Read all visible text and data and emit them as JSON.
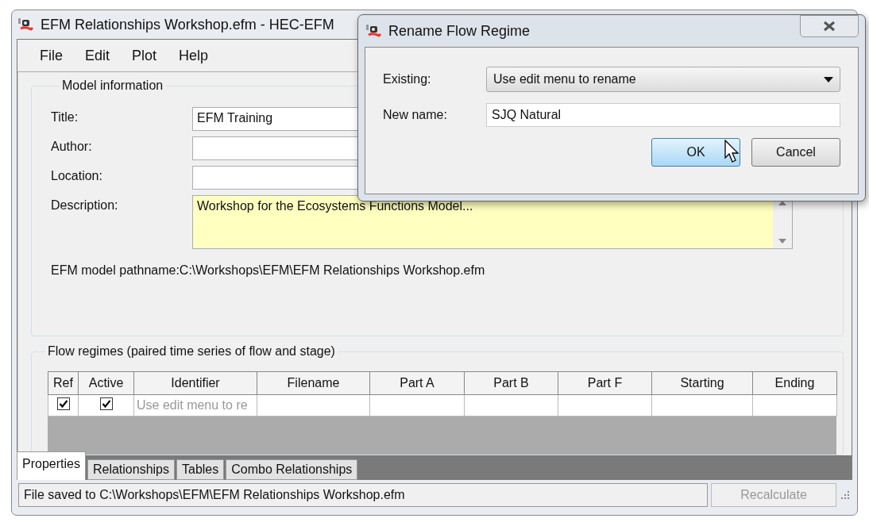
{
  "window": {
    "title": "EFM Relationships Workshop.efm - HEC-EFM"
  },
  "menu": [
    "File",
    "Edit",
    "Plot",
    "Help"
  ],
  "model_info": {
    "title": "Model information",
    "fields": [
      {
        "label": "Title:",
        "value": "EFM Training",
        "kind": "text"
      },
      {
        "label": "Author:",
        "kind": "text"
      },
      {
        "label": "Location:",
        "kind": "text"
      },
      {
        "label": "Description:",
        "value": "Workshop for the Ecosystems Functions Model...",
        "kind": "memo"
      }
    ],
    "pathname": "EFM model pathname:C:\\Workshops\\EFM\\EFM Relationships Workshop.efm"
  },
  "flow_regimes": {
    "title": "Flow regimes (paired time series of flow and stage)",
    "columns": [
      "Ref",
      "Active",
      "Identifier",
      "Filename",
      "Part A",
      "Part B",
      "Part F",
      "Starting",
      "Ending"
    ],
    "rows": [
      {
        "ref": true,
        "active": true,
        "identifier": "Use edit menu to re"
      }
    ]
  },
  "tabs": [
    {
      "label": "Properties",
      "selected": true
    },
    {
      "label": "Relationships",
      "selected": false
    },
    {
      "label": "Tables",
      "selected": false
    },
    {
      "label": "Combo Relationships",
      "selected": false
    }
  ],
  "status_bar": {
    "message": "File saved to C:\\Workshops\\EFM\\EFM Relationships Workshop.efm",
    "button": {
      "label": "Recalculate",
      "disabled": true
    }
  },
  "dialog": {
    "title": "Rename Flow Regime",
    "existing_label": "Existing:",
    "existing_value": "Use edit menu to rename",
    "new_name_label": "New name:",
    "new_name_value": "SJQ Natural",
    "buttons": [
      {
        "label": "OK",
        "default": true
      },
      {
        "label": "Cancel",
        "default": false
      }
    ]
  }
}
